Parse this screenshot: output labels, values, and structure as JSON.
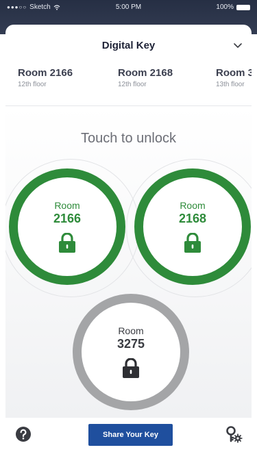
{
  "status_bar": {
    "carrier": "Sketch",
    "time": "5:00 PM",
    "battery": "100%"
  },
  "header": {
    "title": "Digital Key",
    "chevron_icon": "chevron-down-icon"
  },
  "room_tabs": [
    {
      "name": "Room 2166",
      "floor": "12th floor"
    },
    {
      "name": "Room 2168",
      "floor": "12th floor"
    },
    {
      "name": "Room 3",
      "floor": "13th floor"
    }
  ],
  "main": {
    "prompt": "Touch to unlock",
    "locks": [
      {
        "label": "Room",
        "number": "2166",
        "state": "active",
        "color": "#2e8b3a"
      },
      {
        "label": "Room",
        "number": "2168",
        "state": "active",
        "color": "#2e8b3a"
      },
      {
        "label": "Room",
        "number": "3275",
        "state": "inactive",
        "color": "#a4a5a7"
      }
    ]
  },
  "bottom_bar": {
    "help_icon": "question-circle-icon",
    "share_label": "Share Your Key",
    "share_color": "#1f4f9e",
    "settings_icon": "key-gear-icon"
  }
}
